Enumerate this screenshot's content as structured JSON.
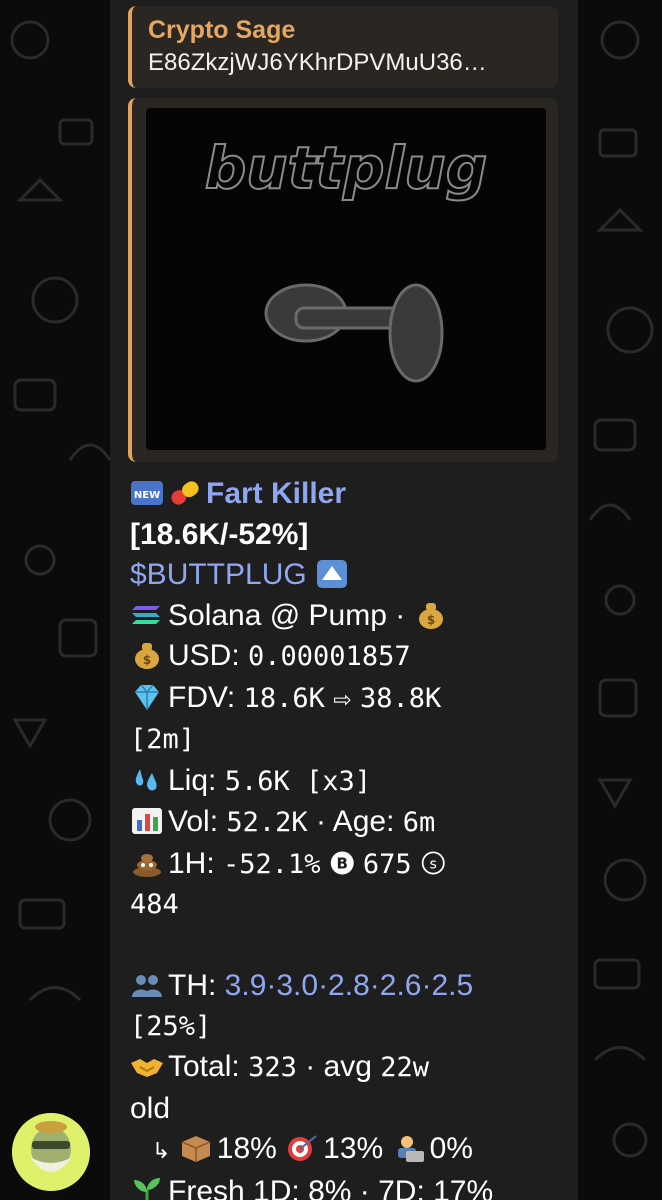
{
  "reply": {
    "sender": "Crypto Sage",
    "text": "E86ZkzjWJ6YKhrDPVMuU36…"
  },
  "media": {
    "logo_text": "buttplug"
  },
  "token": {
    "name": "Fart Killer",
    "mcap_change": "[18.6K/-52%]",
    "ticker": "$BUTTPLUG",
    "chain_line": "Solana @ Pump ·",
    "usd_label": "USD:",
    "usd_value": "0.00001857",
    "fdv_label": "FDV:",
    "fdv_value": "18.6K",
    "fdv_arrow": "⇨",
    "fdv_ath": "38.8K",
    "fdv_time": "[2m]",
    "liq_label": "Liq:",
    "liq_value": "5.6K [x3]",
    "vol_label": "Vol:",
    "vol_value": "52.2K",
    "age_sep": "· Age:",
    "age_value": "6m",
    "h1_label": "1H:",
    "h1_value": "-52.1%",
    "buys": "675",
    "sells_line1": "",
    "sells_value": "484",
    "th_label": "TH:",
    "th_values": "3.9·3.0·2.8·2.6·2.5",
    "th_pct": "[25%]",
    "total_label": "Total:",
    "total_value": "323",
    "avg_label": "· avg",
    "avg_value": "22w",
    "avg_cont": "old",
    "sub_arrow": "↳",
    "sub_1": "18%",
    "sub_2": "13%",
    "sub_3": "0%",
    "fresh_label": "Fresh 1D:",
    "fresh_1d": "8%",
    "fresh_sep": "· 7D:",
    "fresh_7d": "17%"
  },
  "colors": {
    "accent": "#e3a35a",
    "link": "#8fa6f0",
    "bubble": "#1e1e1e"
  }
}
